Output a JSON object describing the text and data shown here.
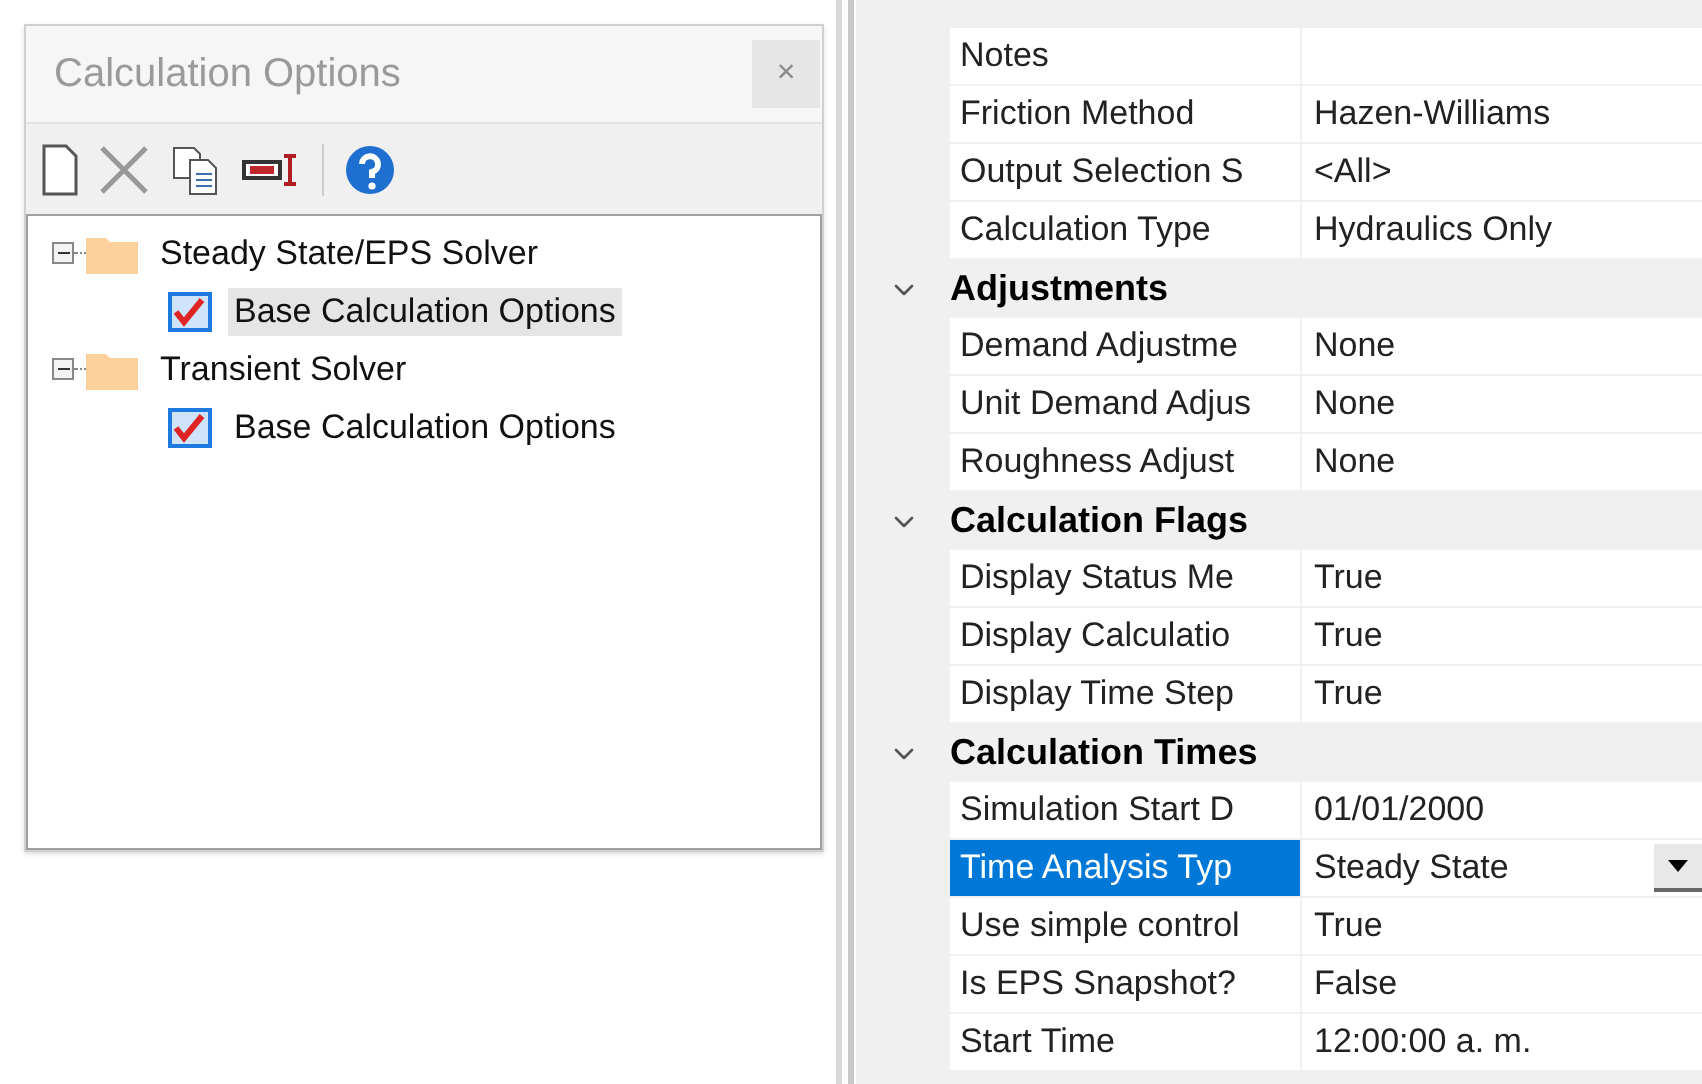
{
  "panel": {
    "title": "Calculation Options",
    "close": "×"
  },
  "tree": [
    {
      "label": "Steady State/EPS Solver",
      "expanded": true,
      "selected": false,
      "children": [
        {
          "label": "Base Calculation Options",
          "selected": true
        }
      ]
    },
    {
      "label": "Transient Solver",
      "expanded": true,
      "selected": false,
      "children": [
        {
          "label": "Base Calculation Options",
          "selected": false
        }
      ]
    }
  ],
  "properties": [
    {
      "rows": [
        {
          "label": "Notes",
          "selected": false
        },
        {
          "label": "Friction Method",
          "value": "Hazen-Williams",
          "selected": false
        },
        {
          "label": "Output Selection S",
          "value": "<All>",
          "selected": false
        },
        {
          "label": "Calculation Type",
          "value": "Hydraulics Only",
          "selected": false
        }
      ]
    },
    {
      "title": "Adjustments",
      "expanded": true,
      "rows": [
        {
          "label": "Demand Adjustme",
          "value": "None",
          "selected": false
        },
        {
          "label": "Unit Demand Adjus",
          "value": "None",
          "selected": false
        },
        {
          "label": "Roughness Adjust",
          "value": "None",
          "selected": false
        }
      ]
    },
    {
      "title": "Calculation Flags",
      "expanded": true,
      "rows": [
        {
          "label": "Display Status Me",
          "value": "True",
          "selected": false
        },
        {
          "label": "Display Calculatio",
          "value": "True",
          "selected": false
        },
        {
          "label": "Display Time Step",
          "value": "True",
          "selected": false
        }
      ]
    },
    {
      "title": "Calculation Times",
      "expanded": true,
      "rows": [
        {
          "label": "Simulation Start D",
          "value": "01/01/2000",
          "selected": false
        },
        {
          "label": "Time Analysis Typ",
          "value": "Steady State",
          "selected": true
        },
        {
          "label": "Use simple control",
          "value": "True",
          "selected": false
        },
        {
          "label": "Is EPS Snapshot?",
          "value": "False",
          "selected": false
        },
        {
          "label": "Start Time",
          "value": "12:00:00 a. m.",
          "selected": false
        }
      ]
    }
  ]
}
